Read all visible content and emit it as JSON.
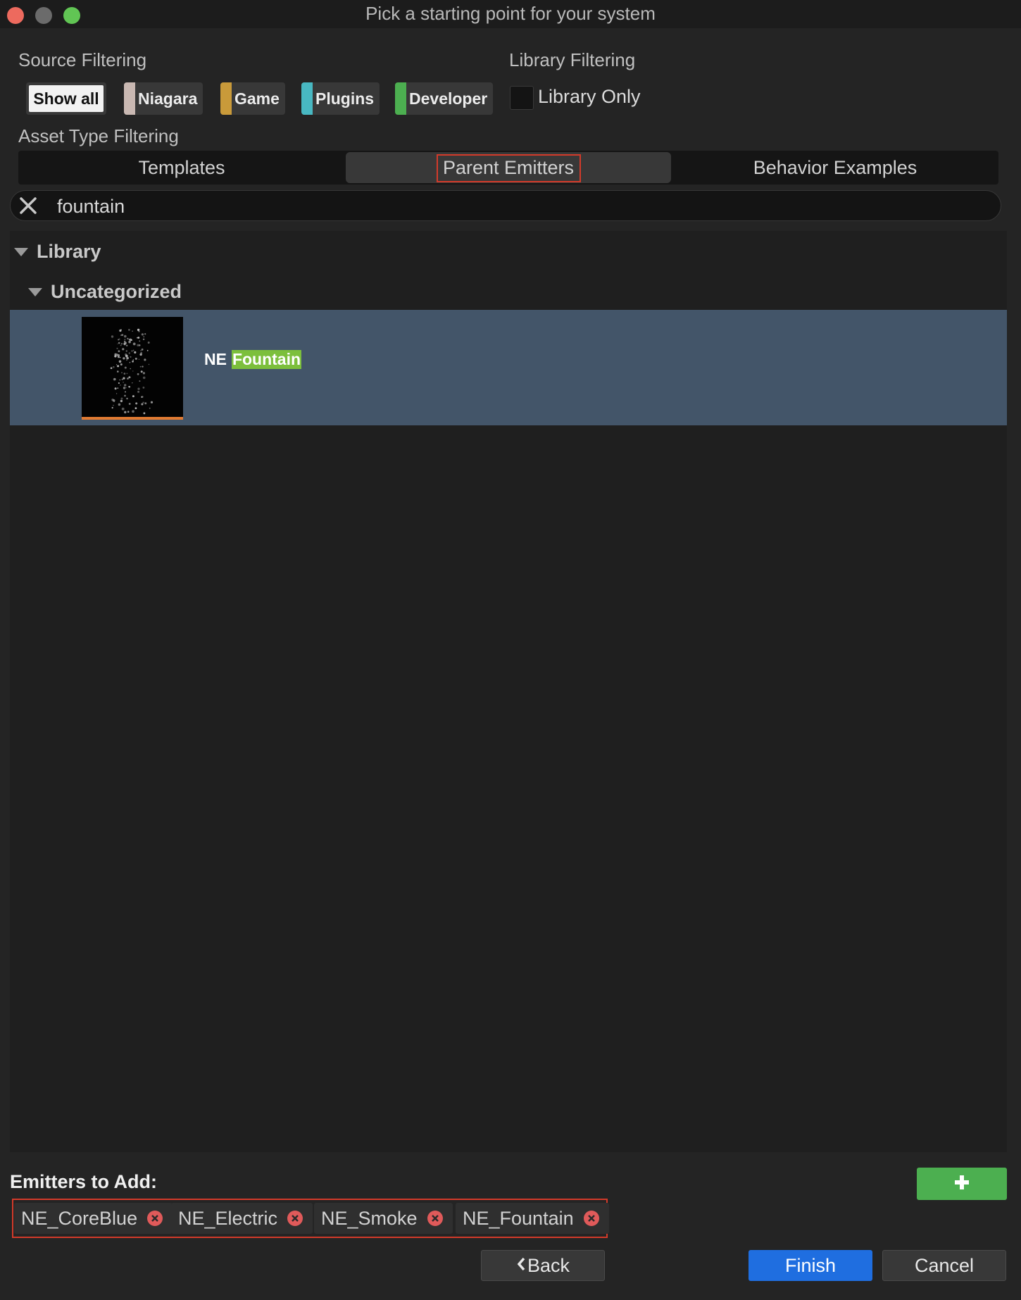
{
  "window": {
    "title": "Pick a starting point for your system"
  },
  "source_filtering": {
    "label": "Source Filtering",
    "show_all": "Show all",
    "chips": [
      {
        "label": "Niagara",
        "color": "#c9b8b2"
      },
      {
        "label": "Game",
        "color": "#c99a3a"
      },
      {
        "label": "Plugins",
        "color": "#48b8c2"
      },
      {
        "label": "Developer",
        "color": "#4caf50"
      }
    ]
  },
  "library_filtering": {
    "label": "Library Filtering",
    "library_only_label": "Library Only"
  },
  "asset_type_filtering": {
    "label": "Asset Type Filtering",
    "tabs": [
      {
        "label": "Templates"
      },
      {
        "label": "Parent Emitters"
      },
      {
        "label": "Behavior Examples"
      }
    ],
    "active_tab": "Parent Emitters"
  },
  "search": {
    "value": "fountain",
    "clear_icon": "close-icon"
  },
  "tree": {
    "root": "Library",
    "category": "Uncategorized",
    "item": {
      "prefix": "NE",
      "match": "Fountain"
    }
  },
  "emitters": {
    "label": "Emitters to Add:",
    "add_icon": "plus-icon",
    "list": [
      "NE_CoreBlue",
      "NE_Electric",
      "NE_Smoke",
      "NE_Fountain"
    ]
  },
  "buttons": {
    "back": "Back",
    "finish": "Finish",
    "cancel": "Cancel"
  }
}
